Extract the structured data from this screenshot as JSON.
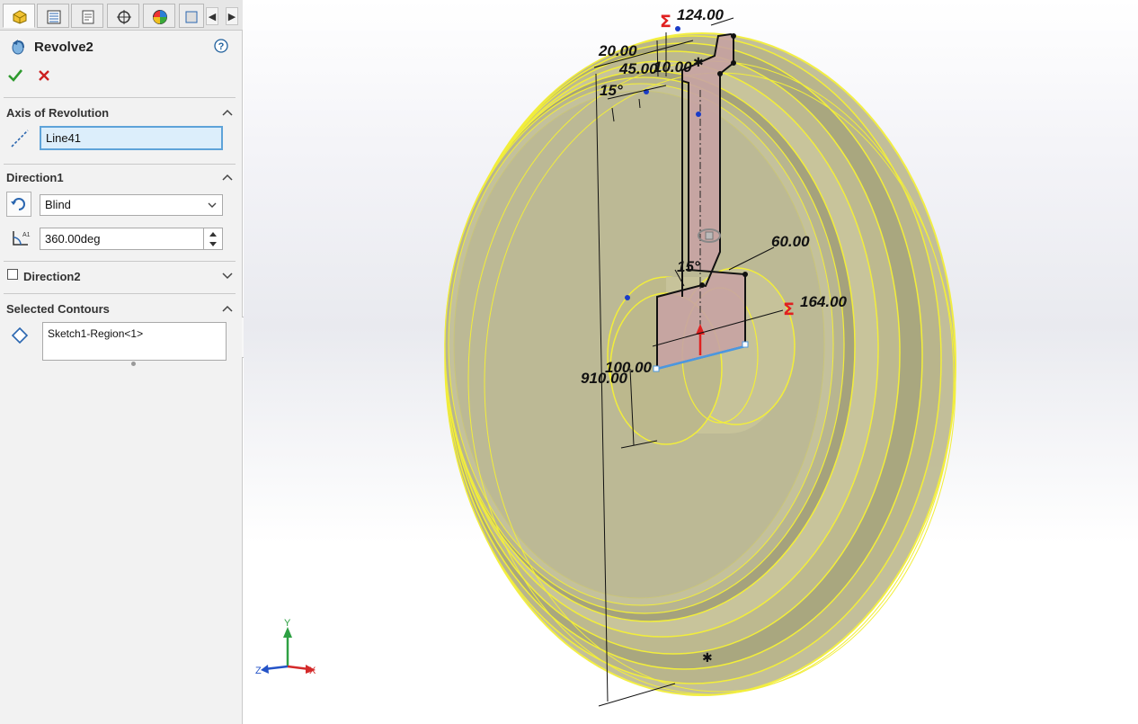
{
  "feature": {
    "title": "Revolve2",
    "help_icon": "help-icon"
  },
  "axis_section": {
    "title": "Axis of Revolution",
    "value": "Line41"
  },
  "direction1": {
    "title": "Direction1",
    "end_condition": "Blind",
    "angle": "360.00deg"
  },
  "direction2": {
    "title": "Direction2",
    "checked": false
  },
  "contours_section": {
    "title": "Selected Contours",
    "value": "Sketch1-Region<1>"
  },
  "dimensions": {
    "d1": "124.00",
    "d2": "20.00",
    "d3": "45.00",
    "d4": "10.00",
    "d5": "15°",
    "d6": "60.00",
    "d7": "15°",
    "d8": "164.00",
    "d9": "910.00",
    "d10": "100.00"
  },
  "triad": {
    "x": "X",
    "y": "Y",
    "z": "Z"
  },
  "colors": {
    "accept": "#2e9a2e",
    "cancel": "#cc2020",
    "highlight": "#ffff00",
    "part": "#b6b38c"
  }
}
